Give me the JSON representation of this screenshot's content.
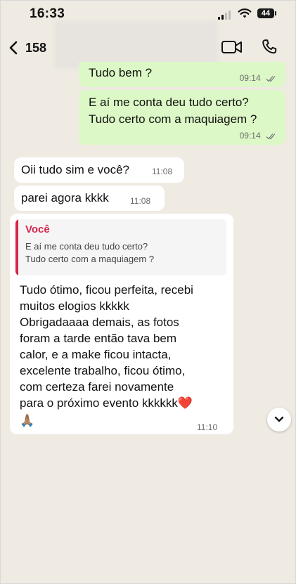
{
  "status_bar": {
    "time": "16:33",
    "battery": "44"
  },
  "header": {
    "unread_count": "158"
  },
  "messages": [
    {
      "direction": "out",
      "text": "Tudo bem ?",
      "time": "09:14"
    },
    {
      "direction": "out",
      "lines": [
        "E aí me conta deu tudo certo?",
        "Tudo certo com a maquiagem ?"
      ],
      "time": "09:14"
    },
    {
      "direction": "in",
      "text": "Oii tudo sim e você?",
      "time": "11:08"
    },
    {
      "direction": "in",
      "text": "parei agora kkkk",
      "time": "11:08"
    },
    {
      "direction": "in",
      "quote": {
        "author": "Você",
        "text": "E aí me conta deu tudo certo?\nTudo certo com a maquiagem ?"
      },
      "lines": [
        "Tudo ótimo, ficou perfeita, recebi",
        "muitos elogios kkkkk",
        "Obrigadaaaa demais, as fotos",
        "foram a tarde então tava bem",
        "calor, e a make ficou intacta,",
        "excelente trabalho, ficou ótimo,",
        "com certeza farei novamente",
        "para o próximo evento kkkkkk❤️",
        "🙏🏽"
      ],
      "time": "11:10"
    }
  ],
  "colors": {
    "outgoing": "#dcf8c6",
    "incoming": "#ffffff",
    "background": "#efeae2",
    "quote_accent": "#d6264b"
  },
  "icons": [
    "back-chevron-icon",
    "video-call-icon",
    "phone-call-icon",
    "double-check-icon",
    "scroll-down-chevron-icon"
  ]
}
